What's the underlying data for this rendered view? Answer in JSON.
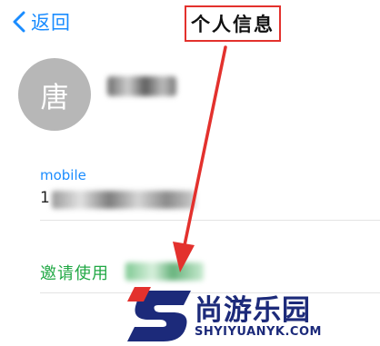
{
  "nav": {
    "back_label": "返回",
    "title": "个人信息"
  },
  "contact": {
    "avatar_text": "唐",
    "phone_label": "mobile",
    "phone_prefix": "1"
  },
  "invite": {
    "label": "邀请使用"
  },
  "watermark": {
    "cn": "尚游乐园",
    "url": "SHYIYUANYK.COM"
  },
  "colors": {
    "accent_blue": "#1a8cff",
    "invite_green": "#21a845",
    "annotation_red": "#e3312d",
    "watermark_navy": "#1c2a7a"
  },
  "icons": {
    "back": "chevron-left-icon"
  }
}
